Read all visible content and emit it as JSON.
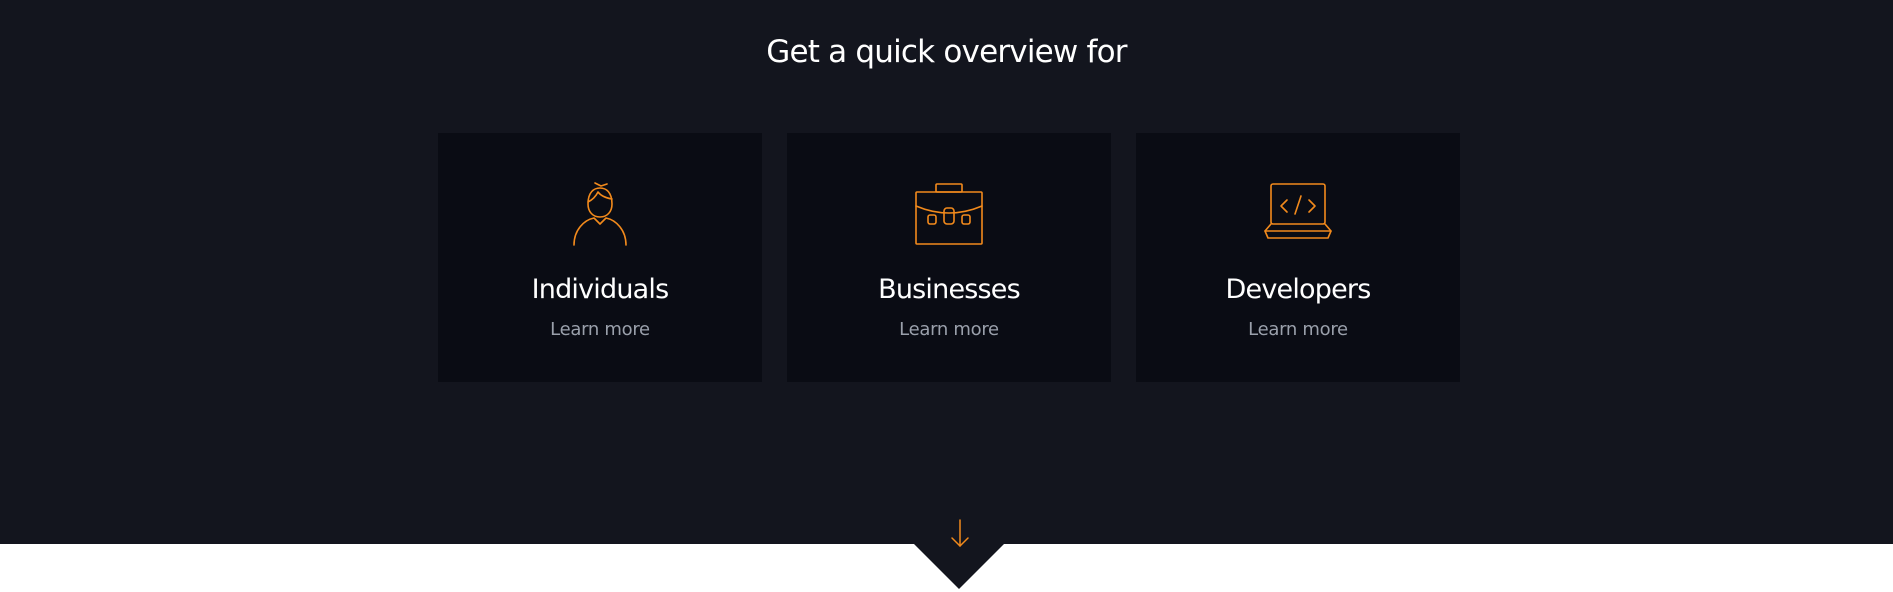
{
  "overview": {
    "heading": "Get a quick overview for",
    "cards": [
      {
        "title": "Individuals",
        "link": "Learn more",
        "icon": "person-icon"
      },
      {
        "title": "Businesses",
        "link": "Learn more",
        "icon": "briefcase-icon"
      },
      {
        "title": "Developers",
        "link": "Learn more",
        "icon": "laptop-code-icon"
      }
    ],
    "scroll_icon": "arrow-down-icon"
  },
  "colors": {
    "background": "#13151e",
    "card_background": "#0a0c14",
    "accent": "#f28a1c",
    "heading_text": "#ffffff",
    "link_text": "#9aa0ab",
    "below_section": "#ffffff"
  }
}
